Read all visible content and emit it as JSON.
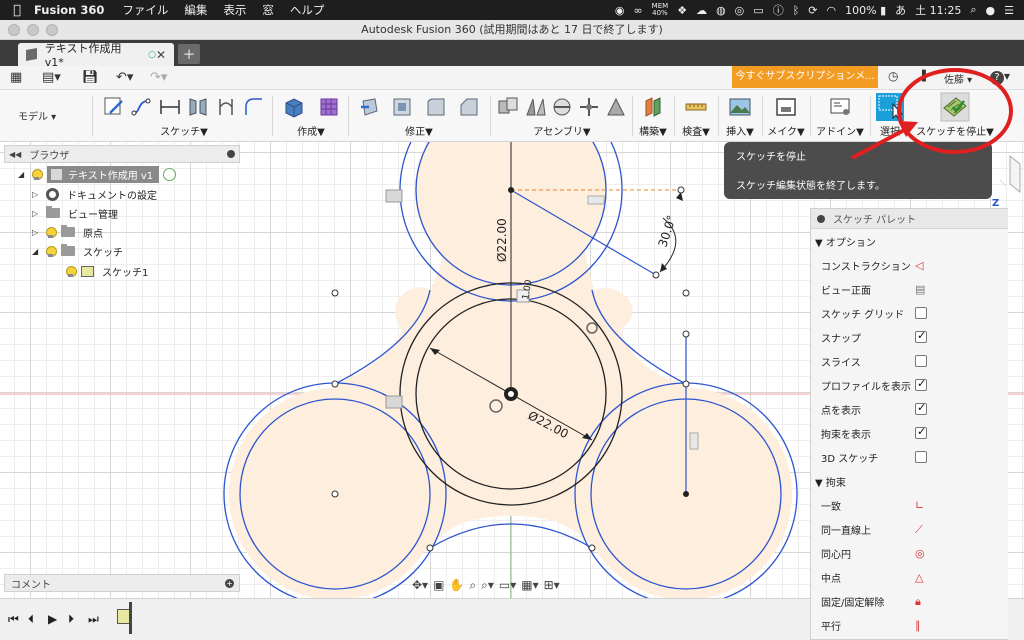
{
  "menubar": {
    "app_name": "Fusion 360",
    "items": [
      "ファイル",
      "編集",
      "表示",
      "窓",
      "ヘルプ"
    ],
    "mem_label": "MEM",
    "mem_value": "40%",
    "battery": "100%",
    "input_mode": "あ",
    "clock": "土 11:25"
  },
  "window": {
    "title": "Autodesk Fusion 360 (試用期間はあと 17 日で終了します)"
  },
  "tab": {
    "name": "テキスト作成用 v1*",
    "new_tab": "+"
  },
  "quickbar": {
    "subscribe_label": "今すぐサブスクリプションメ...",
    "user": "佐藤",
    "help": "?"
  },
  "toolbar": {
    "workspace": "モデル",
    "groups": [
      {
        "label": "スケッチ▼"
      },
      {
        "label": "作成▼"
      },
      {
        "label": "修正▼"
      },
      {
        "label": "アセンブリ▼"
      },
      {
        "label": "構築▼"
      },
      {
        "label": "検査▼"
      },
      {
        "label": "挿入▼"
      },
      {
        "label": "メイク▼"
      },
      {
        "label": "アドイン▼"
      },
      {
        "label": "選択"
      },
      {
        "label": "スケッチを停止▼"
      }
    ]
  },
  "browser": {
    "title": "ブラウザ",
    "root": "テキスト作成用 v1",
    "items": [
      "ドキュメントの設定",
      "ビュー管理",
      "原点",
      "スケッチ",
      "スケッチ1"
    ]
  },
  "comment": {
    "title": "コメント"
  },
  "tooltip": {
    "title": "スケッチを停止",
    "body": "スケッチ編集状態を終了します。"
  },
  "sketch": {
    "dim_top": "Ø22.00",
    "dim_center": "Ø22.00",
    "dim_angle": "30.0°",
    "dim_small": "1.00"
  },
  "palette": {
    "title": "スケッチ パレット",
    "options_title": "▼ オプション",
    "options": [
      {
        "label": "コンストラクション",
        "control": "icon",
        "icon": "construction-icon"
      },
      {
        "label": "ビュー正面",
        "control": "icon",
        "icon": "look-at-icon"
      },
      {
        "label": "スケッチ グリッド",
        "control": "checkbox",
        "checked": false
      },
      {
        "label": "スナップ",
        "control": "checkbox",
        "checked": true
      },
      {
        "label": "スライス",
        "control": "checkbox",
        "checked": false
      },
      {
        "label": "プロファイルを表示",
        "control": "checkbox",
        "checked": true
      },
      {
        "label": "点を表示",
        "control": "checkbox",
        "checked": true
      },
      {
        "label": "拘束を表示",
        "control": "checkbox",
        "checked": true
      },
      {
        "label": "3D スケッチ",
        "control": "checkbox",
        "checked": false
      }
    ],
    "constraints_title": "▼ 拘束",
    "constraints": [
      {
        "label": "一致",
        "icon": "coincident-icon"
      },
      {
        "label": "同一直線上",
        "icon": "collinear-icon"
      },
      {
        "label": "同心円",
        "icon": "concentric-icon"
      },
      {
        "label": "中点",
        "icon": "midpoint-icon"
      },
      {
        "label": "固定/固定解除",
        "icon": "lock-icon"
      },
      {
        "label": "平行",
        "icon": "parallel-icon"
      }
    ]
  },
  "colors": {
    "accent_orange": "#f39c24",
    "sketch_blue": "#2d55d0",
    "annotation_red": "#e02020",
    "profile_fill": "#fdeedd"
  }
}
